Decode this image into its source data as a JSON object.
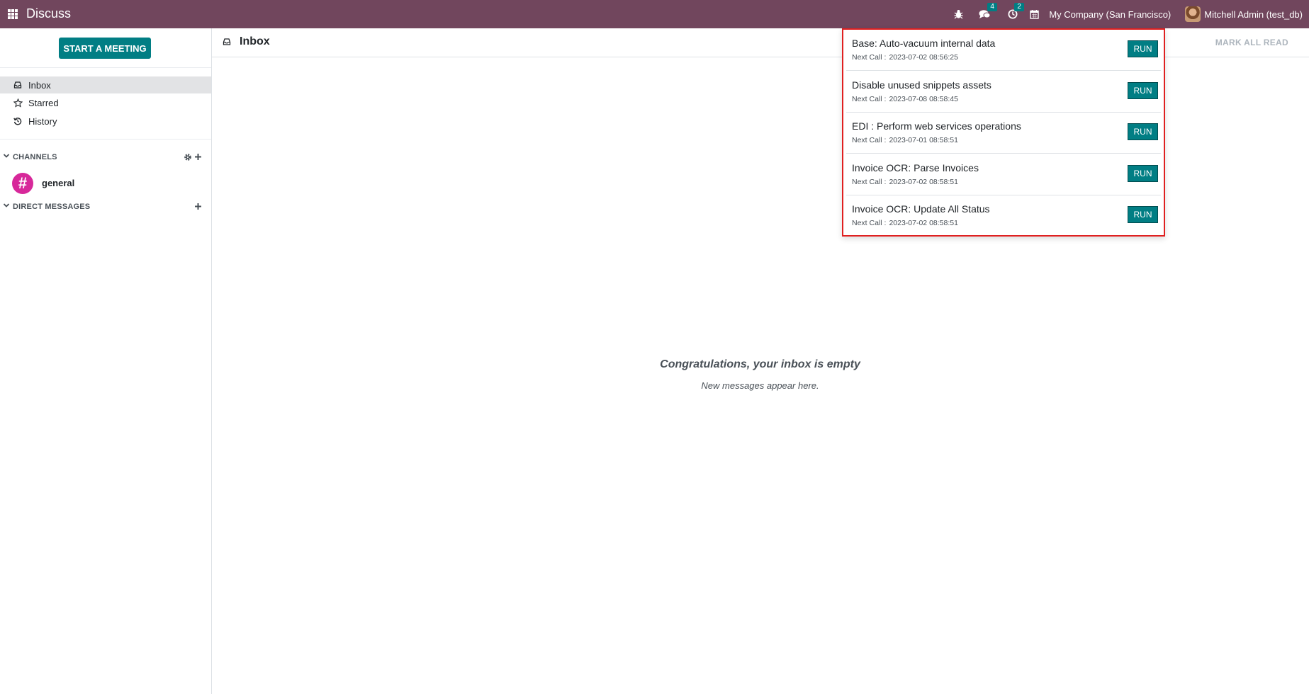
{
  "navbar": {
    "app_title": "Discuss",
    "messages_count": "4",
    "activities_count": "2",
    "company": "My Company (San Francisco)",
    "user": "Mitchell Admin (test_db)",
    "icons": [
      "apps-icon",
      "bug-icon",
      "chat-icon",
      "clock-icon",
      "calendar-icon"
    ]
  },
  "sidebar": {
    "start_meeting": "START A MEETING",
    "mailboxes": [
      {
        "label": "Inbox",
        "icon": "inbox-icon"
      },
      {
        "label": "Starred",
        "icon": "star-icon"
      },
      {
        "label": "History",
        "icon": "history-icon"
      }
    ],
    "channels_header": "CHANNELS",
    "channels": [
      {
        "name": "general",
        "avatar_glyph": "#"
      }
    ],
    "direct_messages_header": "DIRECT MESSAGES"
  },
  "main": {
    "title": "Inbox",
    "mark_all_read": "MARK ALL READ",
    "empty_title": "Congratulations, your inbox is empty",
    "empty_subtitle": "New messages appear here."
  },
  "cron_panel": {
    "next_call_label": "Next Call :",
    "run_label": "RUN",
    "items": [
      {
        "name": "Base: Auto-vacuum internal data",
        "next_call": "2023-07-02 08:56:25"
      },
      {
        "name": "Disable unused snippets assets",
        "next_call": "2023-07-08 08:58:45"
      },
      {
        "name": "EDI : Perform web services operations",
        "next_call": "2023-07-01 08:58:51"
      },
      {
        "name": "Invoice OCR: Parse Invoices",
        "next_call": "2023-07-02 08:58:51"
      },
      {
        "name": "Invoice OCR: Update All Status",
        "next_call": "2023-07-02 08:58:51"
      }
    ]
  },
  "colors": {
    "navbar": "#71465d",
    "primary": "#017e84",
    "highlight_border": "#e02020",
    "channel_avatar": "#d7289a"
  }
}
